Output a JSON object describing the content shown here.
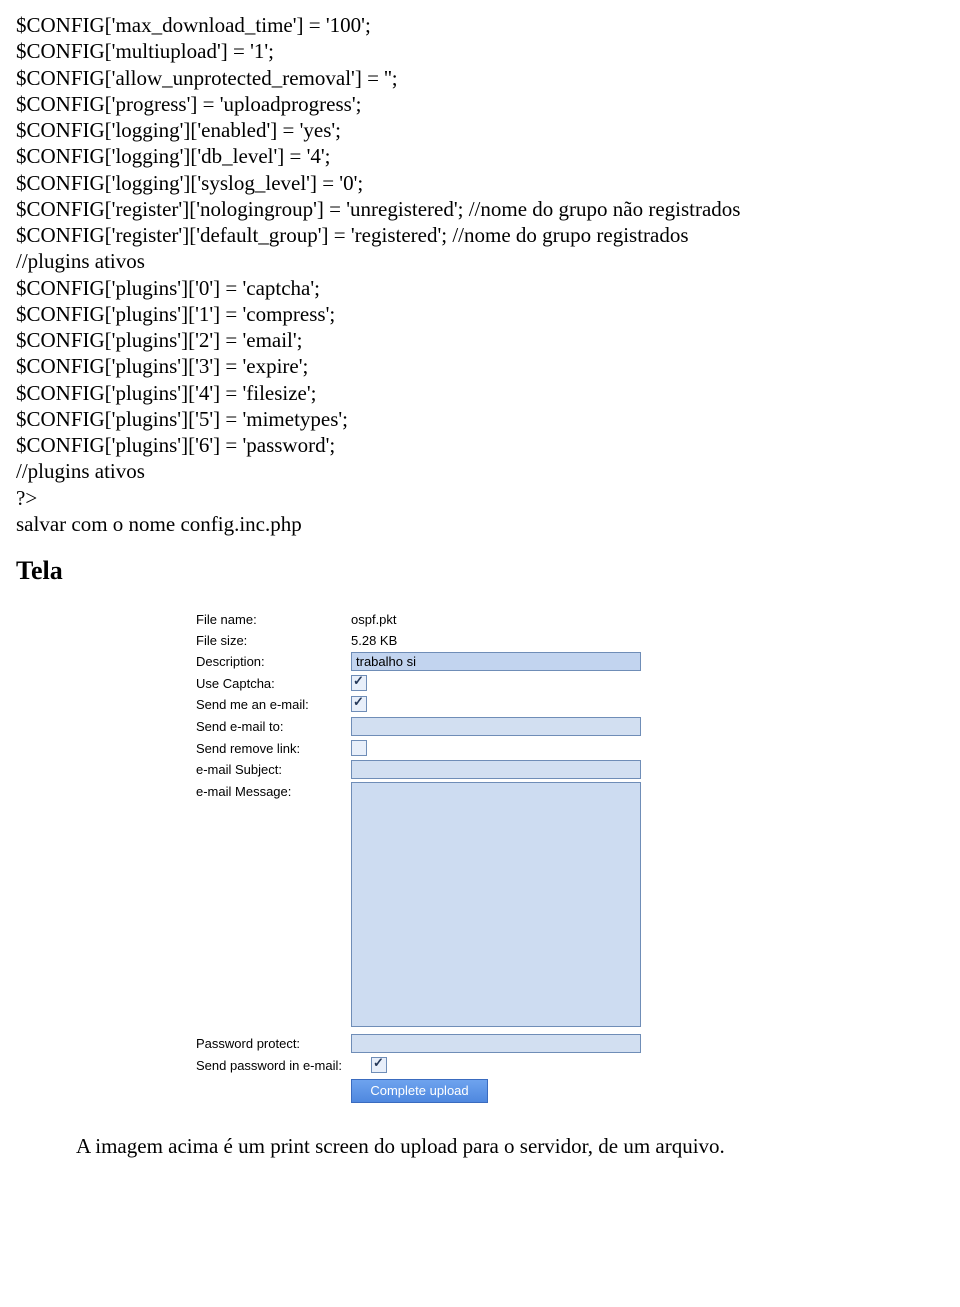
{
  "code": {
    "lines": [
      "$CONFIG['max_download_time'] = '100';",
      "$CONFIG['multiupload'] = '1';",
      "$CONFIG['allow_unprotected_removal'] = '';",
      "$CONFIG['progress'] = 'uploadprogress';",
      "$CONFIG['logging']['enabled'] = 'yes';",
      "$CONFIG['logging']['db_level'] = '4';",
      "$CONFIG['logging']['syslog_level'] = '0';",
      "$CONFIG['register']['nologingroup'] = 'unregistered'; //nome do grupo não registrados",
      "$CONFIG['register']['default_group'] = 'registered'; //nome do grupo registrados",
      "//plugins ativos",
      "$CONFIG['plugins']['0'] = 'captcha';",
      "$CONFIG['plugins']['1'] = 'compress';",
      "$CONFIG['plugins']['2'] = 'email';",
      "$CONFIG['plugins']['3'] = 'expire';",
      "$CONFIG['plugins']['4'] = 'filesize';",
      "$CONFIG['plugins']['5'] = 'mimetypes';",
      "$CONFIG['plugins']['6'] = 'password';",
      "//plugins ativos",
      "?>",
      "salvar com o nome config.inc.php"
    ]
  },
  "heading": "Tela",
  "form": {
    "file_name": {
      "label": "File name:",
      "value": "ospf.pkt"
    },
    "file_size": {
      "label": "File size:",
      "value": "5.28 KB"
    },
    "description": {
      "label": "Description:",
      "value": "trabalho si"
    },
    "use_captcha": {
      "label": "Use Captcha:",
      "checked": true
    },
    "send_me_email": {
      "label": "Send me an e-mail:",
      "checked": true
    },
    "send_email_to": {
      "label": "Send e-mail to:",
      "value": ""
    },
    "send_remove_link": {
      "label": "Send remove link:",
      "checked": false
    },
    "email_subject": {
      "label": "e-mail Subject:",
      "value": ""
    },
    "email_message": {
      "label": "e-mail Message:",
      "value": ""
    },
    "password_protect": {
      "label": "Password protect:",
      "value": ""
    },
    "send_password_email": {
      "label": "Send password in e-mail:",
      "checked": true
    },
    "button": "Complete upload"
  },
  "caption": "A imagem acima é um print screen do upload para o servidor, de um arquivo."
}
